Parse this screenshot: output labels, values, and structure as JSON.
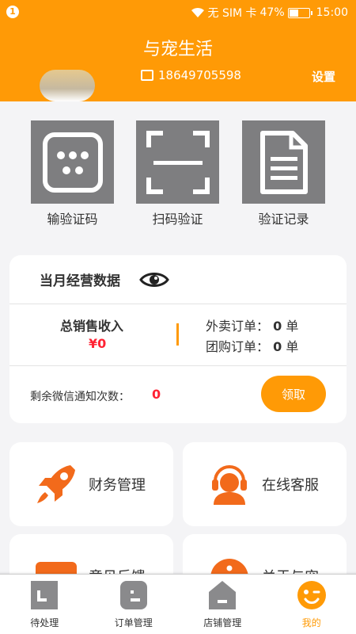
{
  "status_bar": {
    "notification_count": "1",
    "carrier": "无 SIM 卡",
    "battery": "47%",
    "time": "15:00"
  },
  "header": {
    "title": "与宠生活",
    "phone_partial": "18649705598",
    "settings_partial": "设置"
  },
  "quick_actions": [
    {
      "label": "输验证码",
      "icon": "keypad-icon"
    },
    {
      "label": "扫码验证",
      "icon": "scan-icon"
    },
    {
      "label": "验证记录",
      "icon": "document-icon"
    }
  ],
  "stats": {
    "title": "当月经营数据",
    "total_label": "总销售收入",
    "total_value": "¥0",
    "takeout_label": "外卖订单：",
    "takeout_value": "0",
    "group_label": "团购订单：",
    "group_value": "0",
    "order_unit": "单",
    "notify_label": "剩余微信通知次数：",
    "notify_value": "0",
    "claim_label": "领取"
  },
  "menu": [
    {
      "label": "财务管理",
      "icon": "rocket-icon"
    },
    {
      "label": "在线客服",
      "icon": "headset-agent-icon"
    },
    {
      "label": "意见反馈",
      "icon": "chat-icon"
    },
    {
      "label": "关于与宠",
      "icon": "info-icon"
    }
  ],
  "tabs": [
    {
      "label": "待处理",
      "icon": "pending-icon",
      "active": false
    },
    {
      "label": "订单管理",
      "icon": "order-icon",
      "active": false
    },
    {
      "label": "店铺管理",
      "icon": "shop-icon",
      "active": false
    },
    {
      "label": "我的",
      "icon": "smile-icon",
      "active": true
    }
  ],
  "colors": {
    "accent": "#ff9a06",
    "value_red": "#ff2233",
    "tile_gray": "#7e7e80",
    "menu_icon_orange": "#f26a1b"
  }
}
